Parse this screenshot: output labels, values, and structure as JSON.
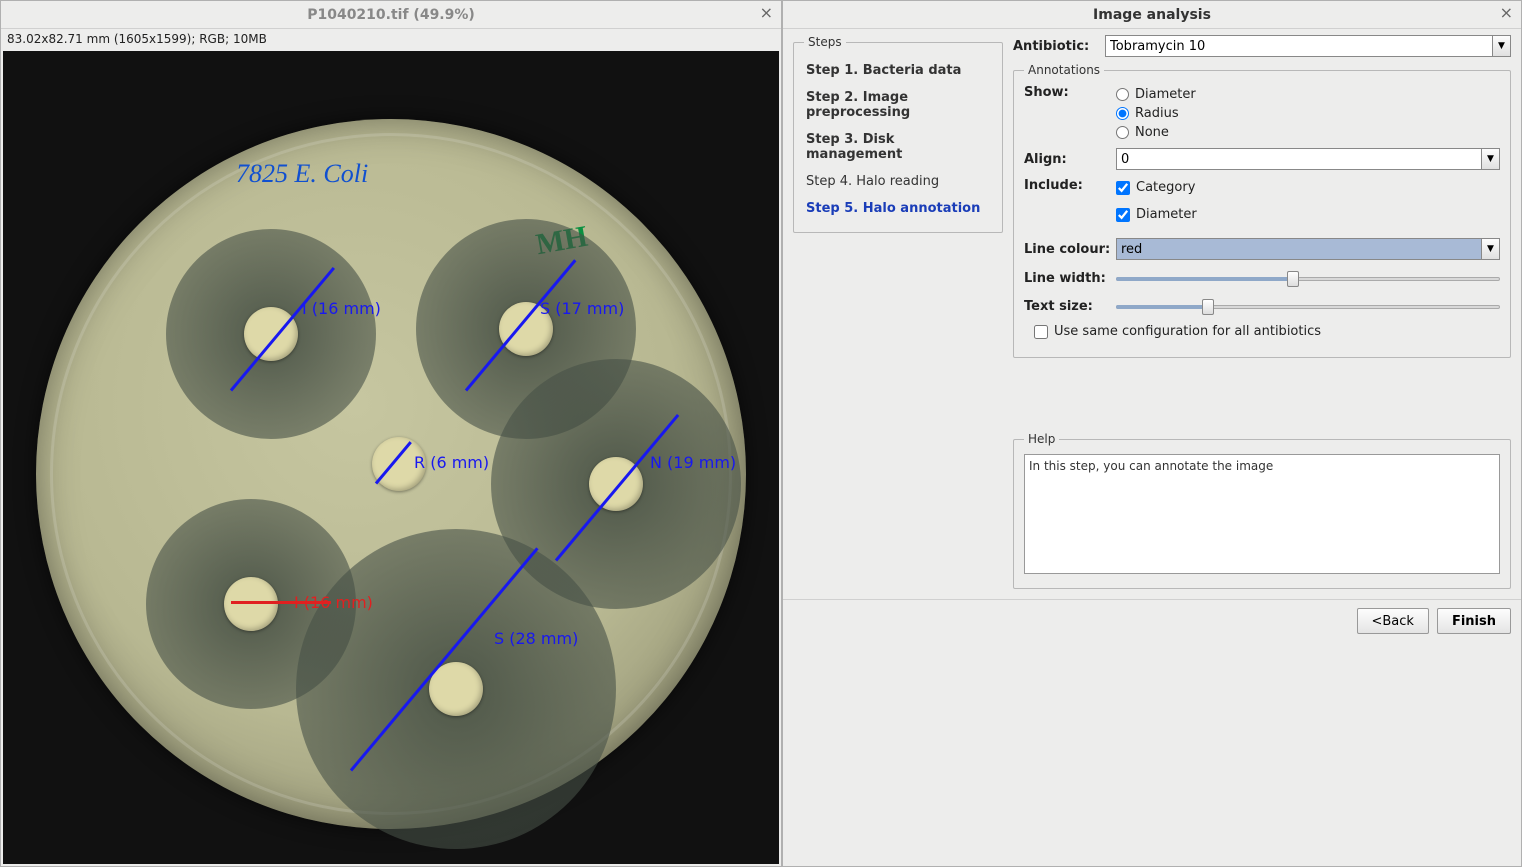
{
  "left": {
    "title": "P1040210.tif (49.9%)",
    "info": "83.02x82.71 mm (1605x1599); RGB; 10MB",
    "handwriting_blue": "7825 E. Coli",
    "handwriting_green": "MH",
    "annotations": [
      {
        "label": "I (16 mm)",
        "color": "blue"
      },
      {
        "label": "S (17 mm)",
        "color": "blue"
      },
      {
        "label": "R (6 mm)",
        "color": "blue"
      },
      {
        "label": "N (19 mm)",
        "color": "blue"
      },
      {
        "label": "I (16 mm)",
        "color": "red"
      },
      {
        "label": "S (28 mm)",
        "color": "blue"
      }
    ]
  },
  "right": {
    "title": "Image analysis",
    "steps": {
      "legend": "Steps",
      "items": [
        {
          "label": "Step 1. Bacteria data",
          "bold": true
        },
        {
          "label": "Step 2. Image preprocessing",
          "bold": true
        },
        {
          "label": "Step 3. Disk management",
          "bold": true
        },
        {
          "label": "Step 4. Halo reading",
          "bold": false
        },
        {
          "label": "Step 5. Halo annotation",
          "active": true
        }
      ]
    },
    "antibiotic": {
      "label": "Antibiotic:",
      "value": "Tobramycin 10"
    },
    "annotations_legend": "Annotations",
    "show": {
      "label": "Show:",
      "options": [
        "Diameter",
        "Radius",
        "None"
      ],
      "selected": "Radius"
    },
    "align": {
      "label": "Align:",
      "value": "0"
    },
    "include": {
      "label": "Include:",
      "category": "Category",
      "diameter": "Diameter"
    },
    "line_colour": {
      "label": "Line colour:",
      "value": "red"
    },
    "line_width": {
      "label": "Line width:",
      "pct": 46
    },
    "text_size": {
      "label": "Text size:",
      "pct": 24
    },
    "use_same": "Use same configuration for all antibiotics",
    "help": {
      "legend": "Help",
      "text": "In this step, you can annotate the image"
    },
    "buttons": {
      "back": "<Back",
      "finish": "Finish"
    }
  }
}
